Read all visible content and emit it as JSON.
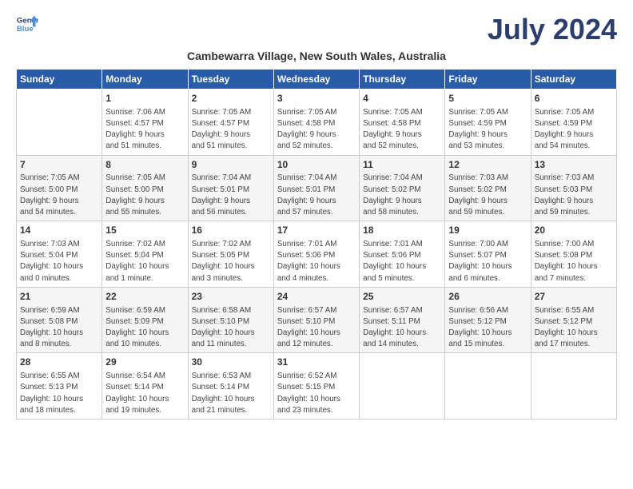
{
  "logo": {
    "line1": "General",
    "line2": "Blue"
  },
  "title": "July 2024",
  "subtitle": "Cambewarra Village, New South Wales, Australia",
  "weekdays": [
    "Sunday",
    "Monday",
    "Tuesday",
    "Wednesday",
    "Thursday",
    "Friday",
    "Saturday"
  ],
  "weeks": [
    [
      {
        "day": "",
        "info": ""
      },
      {
        "day": "1",
        "info": "Sunrise: 7:06 AM\nSunset: 4:57 PM\nDaylight: 9 hours\nand 51 minutes."
      },
      {
        "day": "2",
        "info": "Sunrise: 7:05 AM\nSunset: 4:57 PM\nDaylight: 9 hours\nand 51 minutes."
      },
      {
        "day": "3",
        "info": "Sunrise: 7:05 AM\nSunset: 4:58 PM\nDaylight: 9 hours\nand 52 minutes."
      },
      {
        "day": "4",
        "info": "Sunrise: 7:05 AM\nSunset: 4:58 PM\nDaylight: 9 hours\nand 52 minutes."
      },
      {
        "day": "5",
        "info": "Sunrise: 7:05 AM\nSunset: 4:59 PM\nDaylight: 9 hours\nand 53 minutes."
      },
      {
        "day": "6",
        "info": "Sunrise: 7:05 AM\nSunset: 4:59 PM\nDaylight: 9 hours\nand 54 minutes."
      }
    ],
    [
      {
        "day": "7",
        "info": "Sunrise: 7:05 AM\nSunset: 5:00 PM\nDaylight: 9 hours\nand 54 minutes."
      },
      {
        "day": "8",
        "info": "Sunrise: 7:05 AM\nSunset: 5:00 PM\nDaylight: 9 hours\nand 55 minutes."
      },
      {
        "day": "9",
        "info": "Sunrise: 7:04 AM\nSunset: 5:01 PM\nDaylight: 9 hours\nand 56 minutes."
      },
      {
        "day": "10",
        "info": "Sunrise: 7:04 AM\nSunset: 5:01 PM\nDaylight: 9 hours\nand 57 minutes."
      },
      {
        "day": "11",
        "info": "Sunrise: 7:04 AM\nSunset: 5:02 PM\nDaylight: 9 hours\nand 58 minutes."
      },
      {
        "day": "12",
        "info": "Sunrise: 7:03 AM\nSunset: 5:02 PM\nDaylight: 9 hours\nand 59 minutes."
      },
      {
        "day": "13",
        "info": "Sunrise: 7:03 AM\nSunset: 5:03 PM\nDaylight: 9 hours\nand 59 minutes."
      }
    ],
    [
      {
        "day": "14",
        "info": "Sunrise: 7:03 AM\nSunset: 5:04 PM\nDaylight: 10 hours\nand 0 minutes."
      },
      {
        "day": "15",
        "info": "Sunrise: 7:02 AM\nSunset: 5:04 PM\nDaylight: 10 hours\nand 1 minute."
      },
      {
        "day": "16",
        "info": "Sunrise: 7:02 AM\nSunset: 5:05 PM\nDaylight: 10 hours\nand 3 minutes."
      },
      {
        "day": "17",
        "info": "Sunrise: 7:01 AM\nSunset: 5:06 PM\nDaylight: 10 hours\nand 4 minutes."
      },
      {
        "day": "18",
        "info": "Sunrise: 7:01 AM\nSunset: 5:06 PM\nDaylight: 10 hours\nand 5 minutes."
      },
      {
        "day": "19",
        "info": "Sunrise: 7:00 AM\nSunset: 5:07 PM\nDaylight: 10 hours\nand 6 minutes."
      },
      {
        "day": "20",
        "info": "Sunrise: 7:00 AM\nSunset: 5:08 PM\nDaylight: 10 hours\nand 7 minutes."
      }
    ],
    [
      {
        "day": "21",
        "info": "Sunrise: 6:59 AM\nSunset: 5:08 PM\nDaylight: 10 hours\nand 8 minutes."
      },
      {
        "day": "22",
        "info": "Sunrise: 6:59 AM\nSunset: 5:09 PM\nDaylight: 10 hours\nand 10 minutes."
      },
      {
        "day": "23",
        "info": "Sunrise: 6:58 AM\nSunset: 5:10 PM\nDaylight: 10 hours\nand 11 minutes."
      },
      {
        "day": "24",
        "info": "Sunrise: 6:57 AM\nSunset: 5:10 PM\nDaylight: 10 hours\nand 12 minutes."
      },
      {
        "day": "25",
        "info": "Sunrise: 6:57 AM\nSunset: 5:11 PM\nDaylight: 10 hours\nand 14 minutes."
      },
      {
        "day": "26",
        "info": "Sunrise: 6:56 AM\nSunset: 5:12 PM\nDaylight: 10 hours\nand 15 minutes."
      },
      {
        "day": "27",
        "info": "Sunrise: 6:55 AM\nSunset: 5:12 PM\nDaylight: 10 hours\nand 17 minutes."
      }
    ],
    [
      {
        "day": "28",
        "info": "Sunrise: 6:55 AM\nSunset: 5:13 PM\nDaylight: 10 hours\nand 18 minutes."
      },
      {
        "day": "29",
        "info": "Sunrise: 6:54 AM\nSunset: 5:14 PM\nDaylight: 10 hours\nand 19 minutes."
      },
      {
        "day": "30",
        "info": "Sunrise: 6:53 AM\nSunset: 5:14 PM\nDaylight: 10 hours\nand 21 minutes."
      },
      {
        "day": "31",
        "info": "Sunrise: 6:52 AM\nSunset: 5:15 PM\nDaylight: 10 hours\nand 23 minutes."
      },
      {
        "day": "",
        "info": ""
      },
      {
        "day": "",
        "info": ""
      },
      {
        "day": "",
        "info": ""
      }
    ]
  ]
}
